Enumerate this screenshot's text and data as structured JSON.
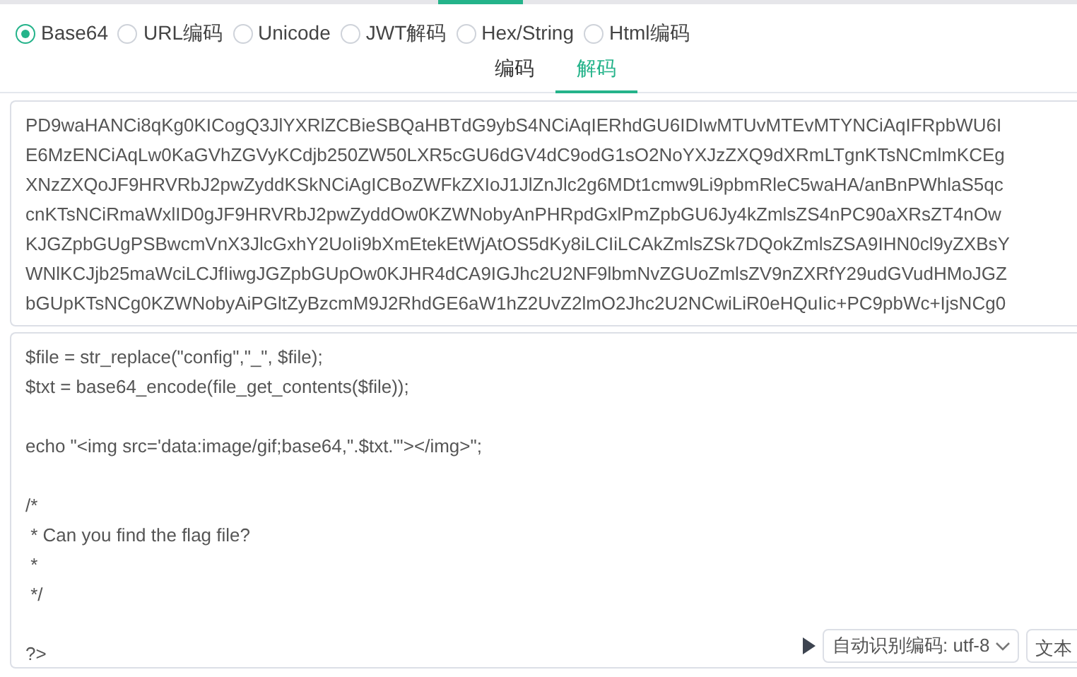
{
  "encodings": [
    {
      "label": "Base64",
      "selected": true
    },
    {
      "label": "URL编码",
      "selected": false
    },
    {
      "label": "Unicode",
      "selected": false
    },
    {
      "label": "JWT解码",
      "selected": false
    },
    {
      "label": "Hex/String",
      "selected": false
    },
    {
      "label": "Html编码",
      "selected": false
    }
  ],
  "tabs": [
    {
      "label": "编码",
      "selected": false
    },
    {
      "label": "解码",
      "selected": true
    }
  ],
  "input_lines": [
    "PD9waHANCi8qKg0KICogQ3JlYXRlZCBieSBQaHBTdG9ybS4NCiAqIERhdGU6IDIwMTUvMTEvMTYNCiAqIFRpbWU6I",
    "E6MzENCiAqLw0KaGVhZGVyKCdjb250ZW50LXR5cGU6dGV4dC9odG1sO2NoYXJzZXQ9dXRmLTgnKTsNCmlmKCEg",
    "XNzZXQoJF9HRVRbJ2pwZyddKSkNCiAgICBoZWFkZXIoJ1JlZnJlc2g6MDt1cmw9Li9pbmRleC5waHA/anBnPWhlaS5qc",
    "cnKTsNCiRmaWxlID0gJF9HRVRbJ2pwZyddOw0KZWNobyAnPHRpdGxlPmZpbGU6Jy4kZmlsZS4nPC90aXRsZT4nOw",
    "KJGZpbGUgPSBwcmVnX3JlcGxhY2UoIi9bXmEtekEtWjAtOS5dKy8iLCIiLCAkZmlsZSk7DQokZmlsZSA9IHN0cl9yZXBsY",
    "WNlKCJjb25maWciLCJfIiwgJGZpbGUpOw0KJHR4dCA9IGJhc2U2NF9lbmNvZGUoZmlsZV9nZXRfY29udGVudHMoJGZ",
    "bGUpKTsNCg0KZWNobyAiPGltZyBzcmM9J2RhdGE6aW1hZ2UvZ2lmO2Jhc2U2NCwiLiR0eHQuIic+PC9pbWc+IjsNCg0"
  ],
  "output_blocks": [
    [
      "$file = str_replace(\"config\",\"_\", $file);",
      "$txt = base64_encode(file_get_contents($file));"
    ],
    [
      "echo \"<img src='data:image/gif;base64,\".$txt.\"'></img>\";"
    ],
    [
      "/*",
      " * Can you find the flag file?",
      " *",
      " */"
    ],
    [
      "?>"
    ]
  ],
  "charset_select": "自动识别编码: utf-8",
  "text_button": "文本"
}
